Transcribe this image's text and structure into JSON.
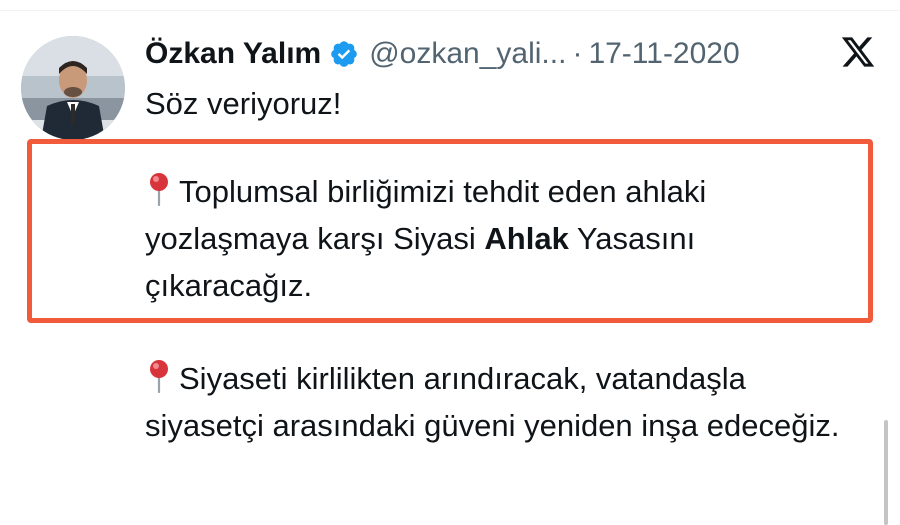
{
  "tweet": {
    "author_name": "Özkan Yalım",
    "handle": "@ozkan_yali...",
    "separator": "·",
    "date": "17-11-2020",
    "first_line": "Söz veriyoruz!",
    "paragraph1": {
      "before": "Toplumsal birliğimizi tehdit eden ahlaki yozlaşmaya karşı Siyasi ",
      "bold": "Ahlak",
      "after": " Yasasını çıkaracağız."
    },
    "paragraph2": "Siyaseti kirlilikten arındıracak, vatandaşla siyasetçi arasındaki güveni yeniden inşa edeceğiz."
  },
  "icons": {
    "verified": "verified-badge-icon",
    "platform": "x-logo-icon",
    "pin": "round-pushpin-icon"
  },
  "colors": {
    "verified_blue": "#1d9bf0",
    "highlight_border": "#f15a3b",
    "muted_text": "#536471",
    "pin_red": "#d8343c"
  }
}
